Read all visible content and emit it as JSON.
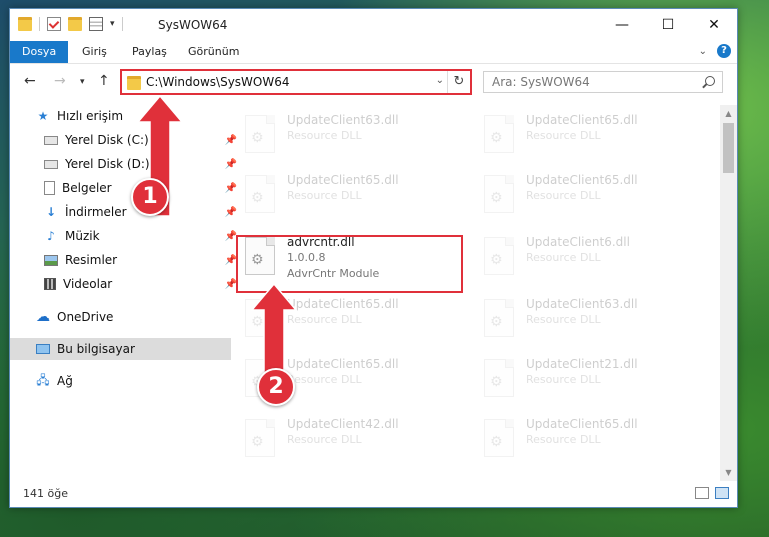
{
  "window": {
    "title": "SysWOW64"
  },
  "ribbon": {
    "tabs": [
      "Dosya",
      "Giriş",
      "Paylaş",
      "Görünüm"
    ]
  },
  "nav": {
    "address": "C:\\Windows\\SysWOW64",
    "search_placeholder": "Ara: SysWOW64"
  },
  "sidebar": {
    "items": [
      {
        "label": "Hızlı erişim",
        "icon": "star-icon"
      },
      {
        "label": "Yerel Disk (C:)",
        "icon": "drive-icon",
        "pinned": true
      },
      {
        "label": "Yerel Disk (D:)",
        "icon": "drive-icon",
        "pinned": true
      },
      {
        "label": "Belgeler",
        "icon": "document-icon",
        "pinned": true
      },
      {
        "label": "İndirmeler",
        "icon": "download-icon",
        "pinned": true
      },
      {
        "label": "Müzik",
        "icon": "music-icon",
        "pinned": true
      },
      {
        "label": "Resimler",
        "icon": "pictures-icon",
        "pinned": true
      },
      {
        "label": "Videolar",
        "icon": "video-icon",
        "pinned": true
      },
      {
        "label": "OneDrive",
        "icon": "cloud-icon"
      },
      {
        "label": "Bu bilgisayar",
        "icon": "computer-icon",
        "selected": true
      },
      {
        "label": "Ağ",
        "icon": "network-icon"
      }
    ]
  },
  "files": [
    {
      "name": "UpdateClient63.dll",
      "line2": "Resource DLL",
      "faded": true
    },
    {
      "name": "UpdateClient65.dll",
      "line2": "Resource DLL",
      "faded": true
    },
    {
      "name": "UpdateClient65.dll",
      "line2": "Resource DLL",
      "faded": true
    },
    {
      "name": "UpdateClient65.dll",
      "line2": "Resource DLL",
      "faded": true
    },
    {
      "name": "advrcntr.dll",
      "line2": "1.0.0.8",
      "line3": "AdvrCntr Module",
      "faded": false,
      "highlighted": true
    },
    {
      "name": "UpdateClient6.dll",
      "line2": "Resource DLL",
      "faded": true
    },
    {
      "name": "UpdateClient65.dll",
      "line2": "Resource DLL",
      "faded": true
    },
    {
      "name": "UpdateClient63.dll",
      "line2": "Resource DLL",
      "faded": true
    },
    {
      "name": "UpdateClient65.dll",
      "line2": "Resource DLL",
      "faded": true
    },
    {
      "name": "UpdateClient21.dll",
      "line2": "Resource DLL",
      "faded": true
    },
    {
      "name": "UpdateClient42.dll",
      "line2": "Resource DLL",
      "faded": true
    },
    {
      "name": "UpdateClient65.dll",
      "line2": "Resource DLL",
      "faded": true
    }
  ],
  "status": {
    "count": "141 öğe"
  },
  "annotations": {
    "step1": "1",
    "step2": "2",
    "color": "#e0303a"
  }
}
